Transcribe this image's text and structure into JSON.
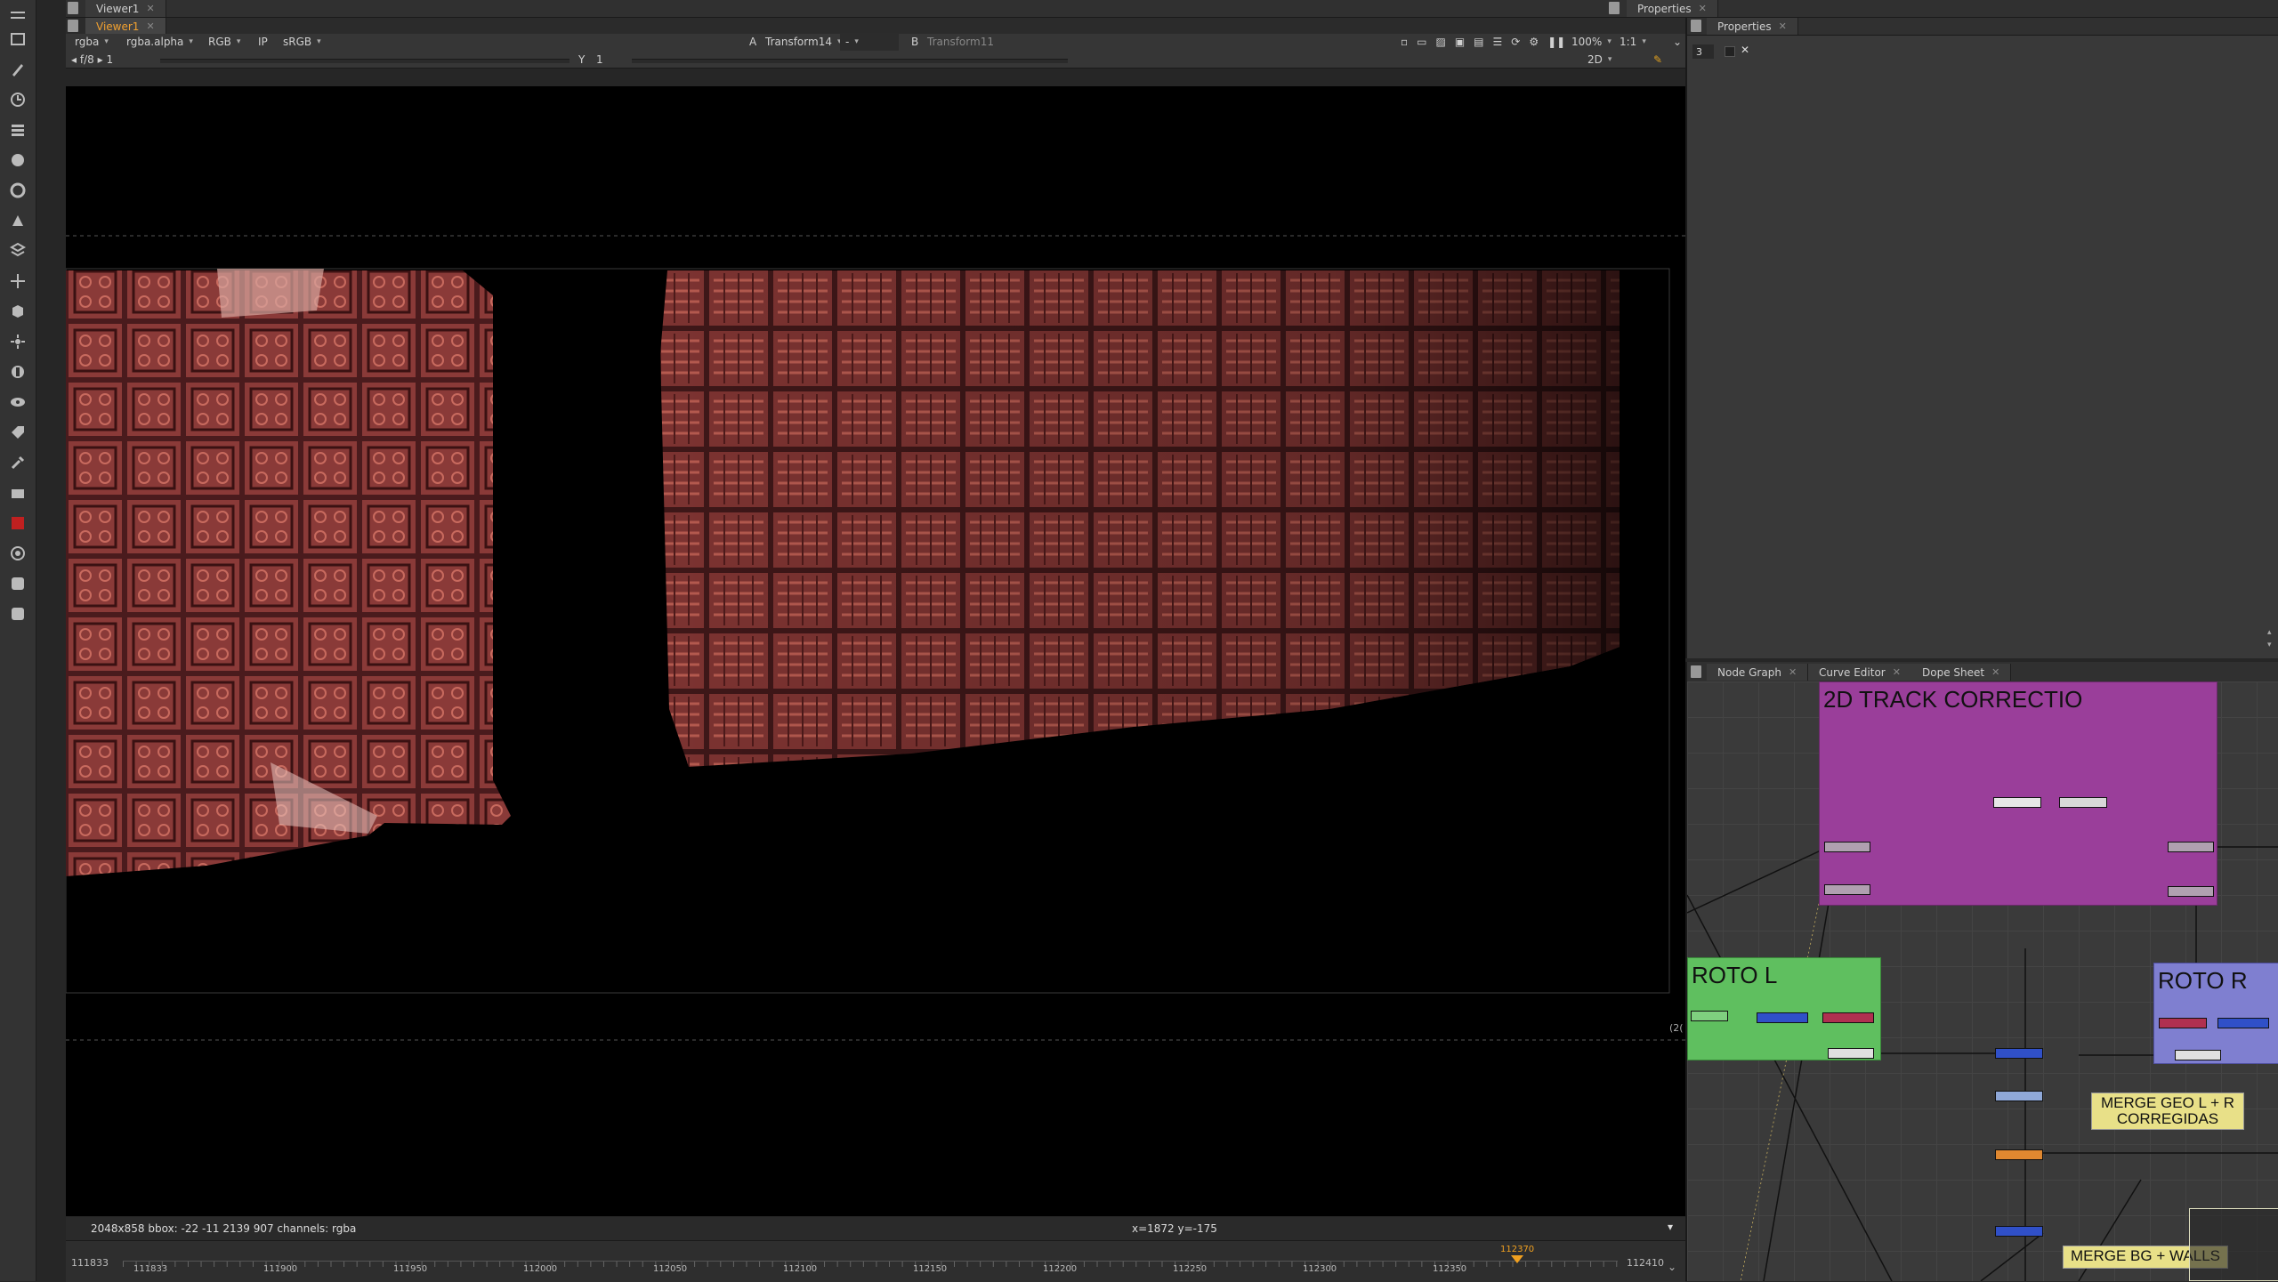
{
  "top_tabs": {
    "viewer_tab": "Viewer1",
    "viewer_subtab": "Viewer1",
    "properties_tab": "Properties",
    "properties_subtab": "Properties"
  },
  "viewer_controls": {
    "channels": "rgba",
    "alpha_channel": "rgba.alpha",
    "display_mode": "RGB",
    "ip_label": "IP",
    "colorspace": "sRGB",
    "input_a_label": "A",
    "input_a": "Transform14",
    "wipe_mode": "-",
    "input_b_label": "B",
    "input_b": "Transform11",
    "zoom": "100%",
    "proxy": "1:1",
    "fstop_label": "f/8",
    "frame_value": "1",
    "gamma_label": "Y",
    "gamma_value": "1",
    "view_mode": "2D"
  },
  "viewer_status": {
    "format_info": "2048x858  bbox: -22 -11 2139 907 channels: rgba",
    "cursor_info": "x=1872 y=-175",
    "edge_label": "(2("
  },
  "timeline": {
    "start_frame": "111833",
    "end_frame": "112410",
    "current_frame": "112370",
    "ticks": [
      "111833",
      "111900",
      "111950",
      "112000",
      "112050",
      "112100",
      "112150",
      "112200",
      "112250",
      "112300",
      "112350",
      "112410"
    ]
  },
  "properties_panel": {
    "max_panels": "3"
  },
  "node_graph_tabs": {
    "node_graph": "Node Graph",
    "curve_editor": "Curve Editor",
    "dope_sheet": "Dope Sheet"
  },
  "node_graph": {
    "backdrop_track": "2D TRACK CORRECTIO",
    "backdrop_roto_l": "ROTO L",
    "backdrop_roto_r": "ROTO R",
    "sticky_merge_geo": "MERGE GEO L + R CORREGIDAS",
    "sticky_merge_bg": "MERGE BG + WALLS",
    "colors": {
      "track_backdrop": "#9a3e9a",
      "roto_l_backdrop": "#5fbf5f",
      "roto_r_backdrop": "#7f7fd0",
      "sticky": "#e8e088"
    }
  }
}
